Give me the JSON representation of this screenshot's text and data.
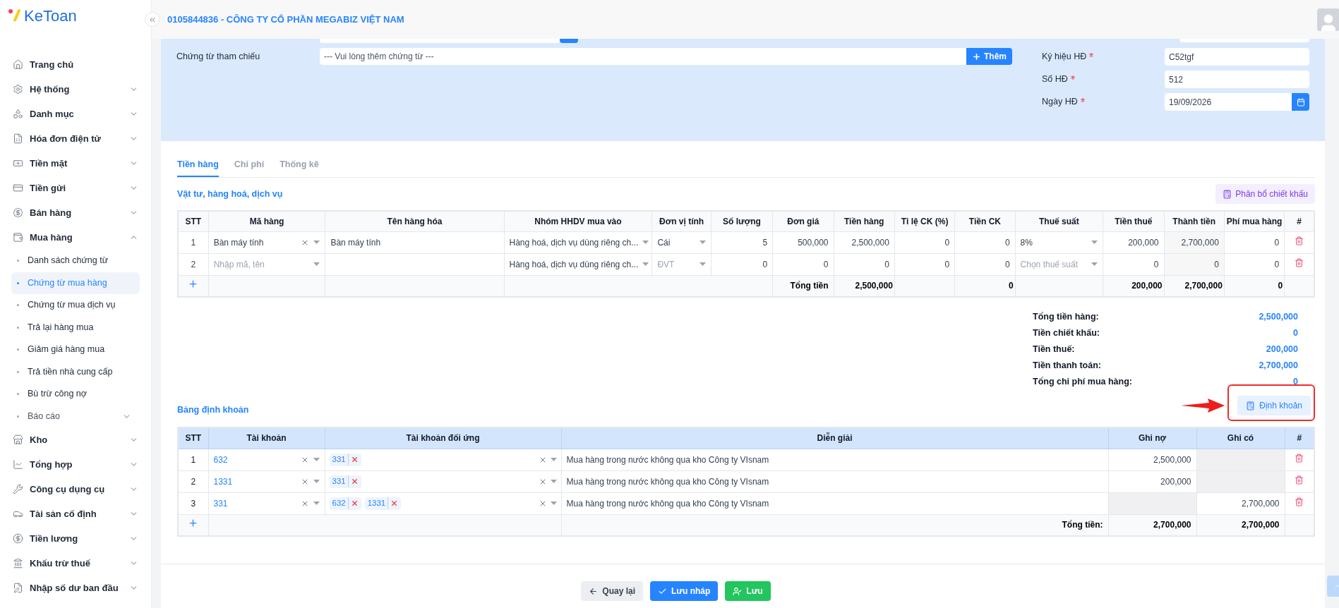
{
  "header": {
    "logo": "KeToan",
    "company": "0105844836 - CÔNG TY CỔ PHẦN MEGABIZ VIỆT NAM"
  },
  "sidebar": {
    "items": [
      {
        "label": "Trang chủ",
        "selected": false
      },
      {
        "label": "Hệ thống",
        "selected": false,
        "expanded": false
      },
      {
        "label": "Danh mục",
        "selected": false,
        "expanded": false
      },
      {
        "label": "Hóa đơn điện tử",
        "selected": false,
        "expanded": false
      },
      {
        "label": "Tiền mặt",
        "selected": false,
        "expanded": false
      },
      {
        "label": "Tiền gửi",
        "selected": false,
        "expanded": false
      },
      {
        "label": "Bán hàng",
        "selected": false,
        "expanded": false
      },
      {
        "label": "Mua hàng",
        "selected": false,
        "expanded": true,
        "children": [
          {
            "label": "Danh sách chứng từ",
            "selected": false
          },
          {
            "label": "Chứng từ mua hàng",
            "selected": true
          },
          {
            "label": "Chứng từ mua dịch vụ",
            "selected": false
          },
          {
            "label": "Trả lại hàng mua",
            "selected": false
          },
          {
            "label": "Giảm giá hàng mua",
            "selected": false
          },
          {
            "label": "Trả tiền nhà cung cấp",
            "selected": false
          },
          {
            "label": "Bù trừ công nợ",
            "selected": false
          },
          {
            "label": "Báo cáo",
            "selected": false,
            "expanded": false
          }
        ]
      },
      {
        "label": "Kho",
        "selected": false,
        "expanded": false
      },
      {
        "label": "Tổng hợp",
        "selected": false,
        "expanded": false
      },
      {
        "label": "Công cụ dụng cụ",
        "selected": false,
        "expanded": false
      },
      {
        "label": "Tài sản cố định",
        "selected": false,
        "expanded": false
      },
      {
        "label": "Tiền lương",
        "selected": false,
        "expanded": false
      },
      {
        "label": "Khấu trừ thuế",
        "selected": false,
        "expanded": false
      },
      {
        "label": "Nhập số dư ban đầu",
        "selected": false,
        "expanded": false
      }
    ]
  },
  "form": {
    "reference": {
      "label": "Chứng từ tham chiếu",
      "placeholder": "--- Vui lòng thêm chứng từ ---",
      "button": "Thêm"
    },
    "fields": [
      {
        "label": "Ký hiệu HĐ",
        "required": true,
        "value": "C52tgf",
        "kind": "text"
      },
      {
        "label": "Số HĐ",
        "required": true,
        "value": "512",
        "kind": "text"
      },
      {
        "label": "Ngày HĐ",
        "required": true,
        "value": "19/09/2026",
        "kind": "date"
      }
    ]
  },
  "tabs": [
    {
      "label": "Tiền hàng",
      "selected": true
    },
    {
      "label": "Chi phí",
      "selected": false
    },
    {
      "label": "Thống kê",
      "selected": false
    }
  ],
  "items": {
    "title": "Vật tư, hàng hoá, dịch vụ",
    "allocate_button": "Phân bổ chiết khấu",
    "columns": [
      "STT",
      "Mã hàng",
      "Tên hàng hóa",
      "Nhóm HHDV mua vào",
      "Đơn vị tính",
      "Số lượng",
      "Đơn giá",
      "Tiền hàng",
      "Tỉ lệ CK (%)",
      "Tiền CK",
      "Thuế suất",
      "Tiền thuế",
      "Thành tiền",
      "Phí mua hàng",
      "#"
    ],
    "rows": [
      {
        "stt": "1",
        "ma_hang": {
          "value": "Bàn máy tính"
        },
        "ten_hang": "Bàn máy tính",
        "nhom": {
          "value": "Hàng hoá, dịch vụ dùng riêng ch..."
        },
        "dvt": {
          "value": "Cái"
        },
        "so_luong": "5",
        "don_gia": "500,000",
        "tien_hang": "2,500,000",
        "ti_le_ck": "0",
        "tien_ck": "0",
        "thue_suat": {
          "value": "8%"
        },
        "tien_thue": "200,000",
        "thanh_tien": "2,700,000",
        "phi_mua_hang": "0"
      },
      {
        "stt": "2",
        "ma_hang": {
          "placeholder": "Nhập mã, tên"
        },
        "nhom": {
          "value": "Hàng hoá, dịch vụ dùng riêng ch..."
        },
        "dvt": {
          "placeholder": "ĐVT"
        },
        "so_luong": "0",
        "don_gia": "0",
        "tien_hang": "0",
        "ti_le_ck": "0",
        "tien_ck": "0",
        "thue_suat": {
          "placeholder": "Chọn thuế suất"
        },
        "tien_thue": "0",
        "thanh_tien": "0",
        "phi_mua_hang": "0"
      }
    ],
    "totals": {
      "label": "Tổng tiền",
      "tien_hang": "2,500,000",
      "tien_ck": "0",
      "tien_thue": "200,000",
      "thanh_tien": "2,700,000",
      "phi_mua_hang": "0"
    }
  },
  "summary": [
    {
      "label": "Tổng tiền hàng:",
      "value": "2,500,000"
    },
    {
      "label": "Tiền chiết khấu:",
      "value": "0"
    },
    {
      "label": "Tiền thuế:",
      "value": "200,000"
    },
    {
      "label": "Tiền thanh toán:",
      "value": "2,700,000"
    },
    {
      "label": "Tổng chi phí mua hàng:",
      "value": "0"
    }
  ],
  "journal": {
    "title": "Bảng định khoản",
    "button": "Định khoản",
    "columns": [
      "STT",
      "Tài khoản",
      "Tài khoản đối ứng",
      "Diễn giải",
      "Ghi nợ",
      "Ghi có",
      "#"
    ],
    "rows": [
      {
        "stt": "1",
        "account": "632",
        "counter_accounts": [
          "331"
        ],
        "description": "Mua hàng trong nước không qua kho Công ty VIsnam",
        "debit": "2,500,000"
      },
      {
        "stt": "2",
        "account": "1331",
        "counter_accounts": [
          "331"
        ],
        "description": "Mua hàng trong nước không qua kho Công ty VIsnam",
        "debit": "200,000"
      },
      {
        "stt": "3",
        "account": "331",
        "counter_accounts": [
          "632",
          "1331"
        ],
        "description": "Mua hàng trong nước không qua kho Công ty VIsnam",
        "credit": "2,700,000"
      }
    ],
    "totals": {
      "label": "Tổng tiền:",
      "debit": "2,700,000",
      "credit": "2,700,000"
    }
  },
  "footer": [
    {
      "label": "Quay lại",
      "kind": "back"
    },
    {
      "label": "Lưu nháp",
      "kind": "draft"
    },
    {
      "label": "Lưu",
      "kind": "save"
    }
  ]
}
